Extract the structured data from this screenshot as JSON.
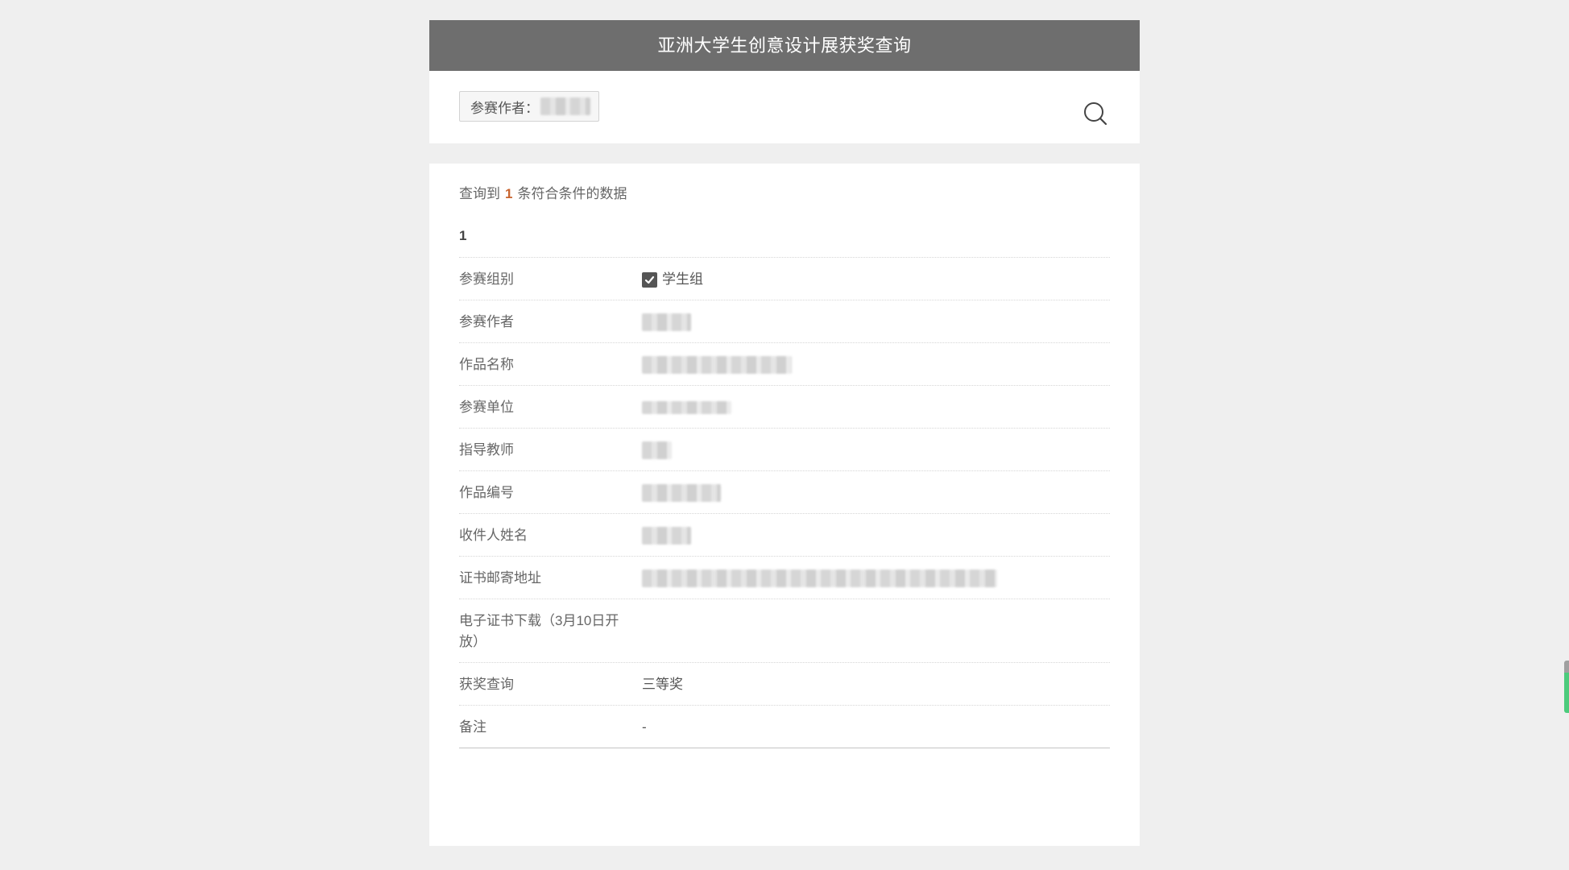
{
  "header": {
    "title": "亚洲大学生创意设计展获奖查询"
  },
  "search": {
    "tag_label": "参赛作者：",
    "icon": "search-icon"
  },
  "results": {
    "summary_prefix": "查询到",
    "count": "1",
    "summary_suffix": "条符合条件的数据",
    "record_index": "1",
    "rows": [
      {
        "label": "参赛组别",
        "value": "学生组",
        "checked": true
      },
      {
        "label": "参赛作者"
      },
      {
        "label": "作品名称"
      },
      {
        "label": "参赛单位"
      },
      {
        "label": "指导教师"
      },
      {
        "label": "作品编号"
      },
      {
        "label": "收件人姓名"
      },
      {
        "label": "证书邮寄地址"
      },
      {
        "label": "电子证书下载（3月10日开放）"
      },
      {
        "label": "获奖查询",
        "value": "三等奖"
      },
      {
        "label": "备注",
        "value": "-"
      }
    ]
  },
  "colors": {
    "page_bg": "#efefef",
    "header_bg": "#6e6e6e",
    "count_accent": "#c8642f",
    "side_tab_green": "#4ccb7c"
  }
}
